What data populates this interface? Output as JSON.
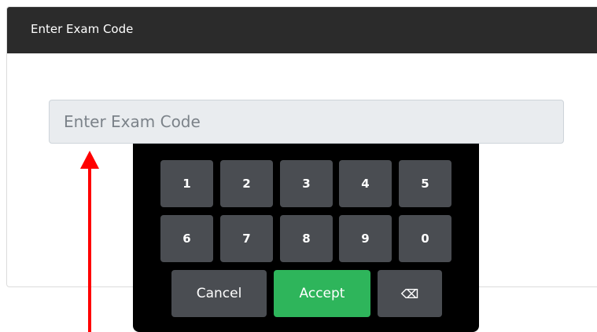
{
  "dialog": {
    "title": "Enter Exam Code"
  },
  "exam_code_input": {
    "value": "",
    "placeholder": "Enter Exam Code"
  },
  "keypad": {
    "row1": [
      "1",
      "2",
      "3",
      "4",
      "5"
    ],
    "row2": [
      "6",
      "7",
      "8",
      "9",
      "0"
    ],
    "cancel_label": "Cancel",
    "accept_label": "Accept",
    "backspace_label": "⌫"
  },
  "colors": {
    "header_bg": "#2b2b2b",
    "keypad_bg": "#000000",
    "key_bg": "#4a4d52",
    "accept_bg": "#2eb55b",
    "input_bg": "#e9ecef",
    "arrow": "#ff0000"
  },
  "annotation": {
    "arrow_icon": "arrow-up-icon"
  }
}
